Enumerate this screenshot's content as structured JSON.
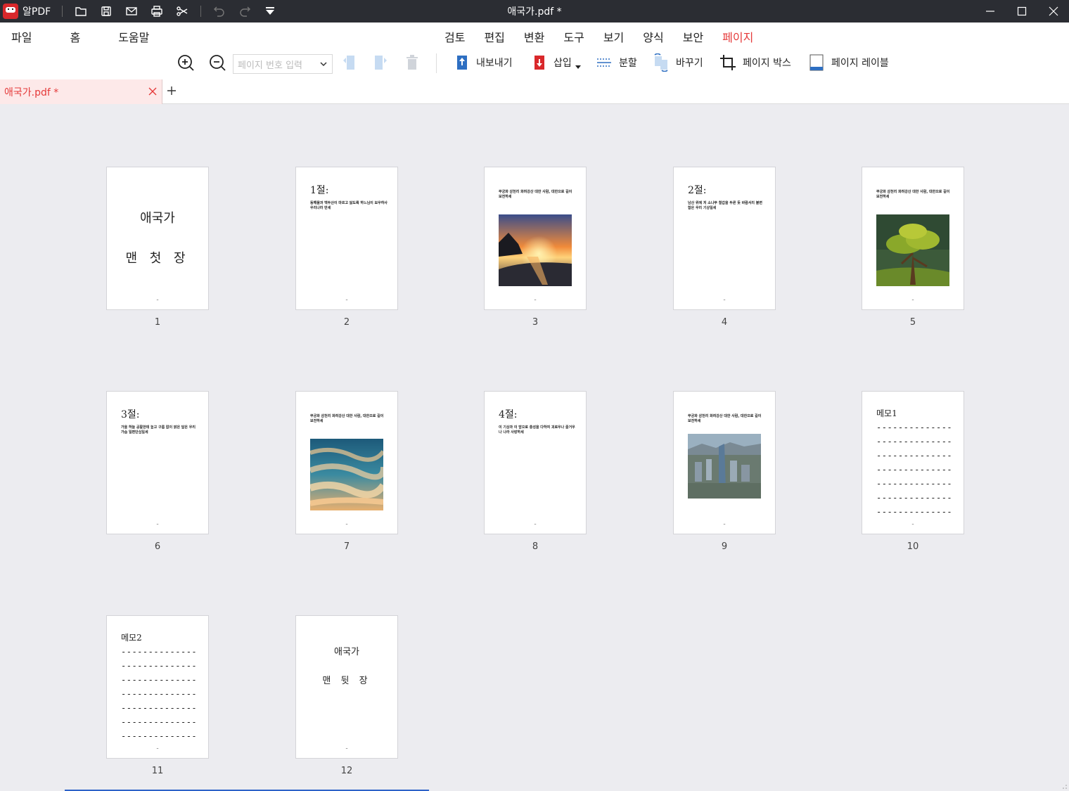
{
  "titlebar": {
    "app_name": "알PDF",
    "doc_title": "애국가.pdf *"
  },
  "menu": {
    "left": [
      "파일",
      "홈",
      "도움말"
    ],
    "center": [
      "검토",
      "편집",
      "변환",
      "도구",
      "보기",
      "양식",
      "보안",
      "페이지"
    ],
    "active": "페이지"
  },
  "toolbar": {
    "page_input_placeholder": "페이지 번호 입력",
    "export": "내보내기",
    "insert": "삽입",
    "split": "분할",
    "replace": "바꾸기",
    "page_box": "페이지 박스",
    "page_label": "페이지 레이블"
  },
  "tab": {
    "title": "애국가.pdf *"
  },
  "pages": [
    {
      "num": "1",
      "type": "cover",
      "line1": "애국가",
      "line2": "맨 첫 장"
    },
    {
      "num": "2",
      "type": "verse",
      "heading": "1절:",
      "text": "동해물과 백두산이 마르고 닳도록 하느님이 보우하사 우리나라 만세"
    },
    {
      "num": "3",
      "type": "image",
      "text": "무궁화 삼천리 화려강산 대한 사람, 대한으로 길이 보전하세",
      "image": "sunset-beach"
    },
    {
      "num": "4",
      "type": "verse",
      "heading": "2절:",
      "text": "남산 위에 저 소나무 철갑을 두른 듯 바람서리 불변함은 우리 기상일세"
    },
    {
      "num": "5",
      "type": "image",
      "text": "무궁화 삼천리 화려강산 대한 사람, 대한으로 길이 보전하세",
      "image": "pine-tree"
    },
    {
      "num": "6",
      "type": "verse",
      "heading": "3절:",
      "text": "가을 하늘 공활한데 높고 구름 없이 밝은 달은 우리 가슴 일편단심일세"
    },
    {
      "num": "7",
      "type": "image",
      "text": "무궁화 삼천리 화려강산 대한 사람, 대한으로 길이 보전하세",
      "image": "clouds"
    },
    {
      "num": "8",
      "type": "verse",
      "heading": "4절:",
      "text": "이 기상과 이 맘으로 충성을 다하여 괴로우나 즐거우나 나라 사랑하세"
    },
    {
      "num": "9",
      "type": "image",
      "text": "무궁화 삼천리 화려강산 대한 사람, 대한으로 길이 보전하세",
      "image": "city"
    },
    {
      "num": "10",
      "type": "memo",
      "heading": "메모1",
      "dashes": "--------------"
    },
    {
      "num": "11",
      "type": "memo",
      "heading": "메모2",
      "dashes": "--------------"
    },
    {
      "num": "12",
      "type": "cover-small",
      "line1": "애국가",
      "line2": "맨 뒷 장"
    }
  ],
  "colors": {
    "accent": "#e53a3a",
    "titlebar": "#2b2d33",
    "workspace": "#ececf0"
  }
}
